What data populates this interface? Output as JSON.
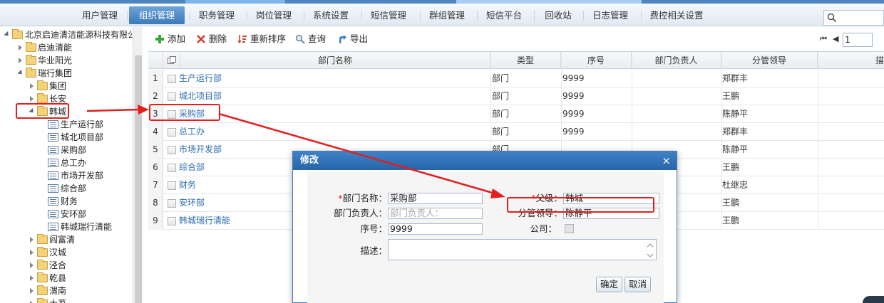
{
  "nav": {
    "items": [
      "用户管理",
      "组织管理",
      "职务管理",
      "岗位管理",
      "系统设置",
      "短信管理",
      "群组管理",
      "短信平台",
      "回收站",
      "日志管理",
      "费控相关设置"
    ],
    "active_index": 1
  },
  "tree": {
    "root": "北京启迪清洁能源科技有限公",
    "companies": [
      "启迪清能",
      "华业阳光",
      "瑞行集团"
    ],
    "ruixing_children": [
      "集团",
      "长安",
      "韩城"
    ],
    "hancheng_children": [
      "生产运行部",
      "城北项目部",
      "采购部",
      "总工办",
      "市场开发部",
      "综合部",
      "财务",
      "安环部",
      "韩城瑞行清能"
    ],
    "more_branches": [
      "阎富清",
      "汉城",
      "泾合",
      "乾县",
      "渭南",
      "大荔"
    ]
  },
  "toolbar": {
    "add": "添加",
    "delete": "删除",
    "reorder": "重新排序",
    "query": "查询",
    "export": "导出"
  },
  "pager": {
    "first": "⏮",
    "prev": "◀",
    "page": "1"
  },
  "grid": {
    "columns": [
      "部门名称",
      "类型",
      "序号",
      "部门负责人",
      "分管领导",
      "描"
    ],
    "rows": [
      {
        "num": "1",
        "name": "生产运行部",
        "type": "部门",
        "seq": "9999",
        "head": "",
        "leader": "郑群丰"
      },
      {
        "num": "2",
        "name": "城北项目部",
        "type": "部门",
        "seq": "9999",
        "head": "",
        "leader": "王鹏"
      },
      {
        "num": "3",
        "name": "采购部",
        "type": "部门",
        "seq": "9999",
        "head": "",
        "leader": "陈静平"
      },
      {
        "num": "4",
        "name": "总工办",
        "type": "部门",
        "seq": "9999",
        "head": "",
        "leader": "郑群丰"
      },
      {
        "num": "5",
        "name": "市场开发部",
        "type": "部门",
        "seq": "",
        "head": "",
        "leader": "陈静平"
      },
      {
        "num": "6",
        "name": "综合部",
        "type": "",
        "seq": "",
        "head": "",
        "leader": "王鹏"
      },
      {
        "num": "7",
        "name": "财务",
        "type": "",
        "seq": "",
        "head": "",
        "leader": "杜继忠"
      },
      {
        "num": "8",
        "name": "安环部",
        "type": "",
        "seq": "",
        "head": "",
        "leader": "王鹏"
      },
      {
        "num": "9",
        "name": "韩城瑞行清能",
        "type": "",
        "seq": "",
        "head": "",
        "leader": "王鹏"
      }
    ]
  },
  "modal": {
    "title": "修改",
    "close": "×",
    "dept_name_label": "部门名称：",
    "dept_name_value": "采购部",
    "dept_head_label": "部门负责人：",
    "dept_head_placeholder": "部门负责人：",
    "seq_label": "序号：",
    "seq_value": "9999",
    "desc_label": "描述：",
    "parent_label": "父级：",
    "parent_value": "韩城",
    "leader_label": "分管领导：",
    "leader_value": "陈静平",
    "company_label": "公司：",
    "ok": "确定",
    "cancel": "取消",
    "required_mark": "*"
  },
  "colors": {
    "nav_active": "#4a86c5",
    "modal_header": "#2f70b4",
    "annotation_red": "#e21f1f",
    "link_blue": "#2d6cb0"
  }
}
